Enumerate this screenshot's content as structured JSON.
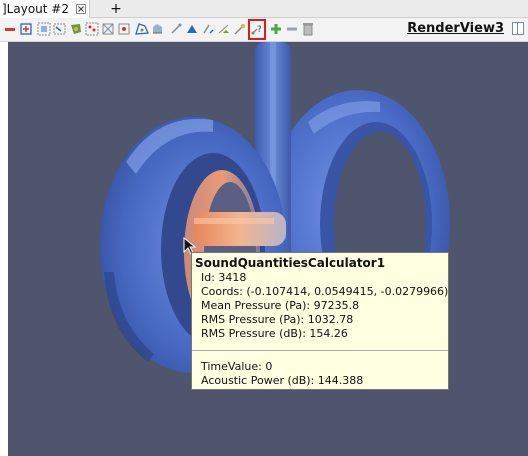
{
  "tabbar": {
    "tab_label": "]Layout #2",
    "add_label": "+"
  },
  "toolbar": {
    "view_name": "RenderView3"
  },
  "tooltip": {
    "title": "SoundQuantitiesCalculator1",
    "id": "Id: 3418",
    "coords": "Coords: (-0.107414, 0.0549415, -0.0279966)",
    "mean_pressure": "Mean Pressure (Pa): 97235.8",
    "rms_pressure_pa": "RMS Pressure (Pa): 1032.78",
    "rms_pressure_db": "RMS Pressure (dB): 154.26",
    "time_value": "TimeValue: 0",
    "acoustic_power": "Acoustic Power (dB): 144.388"
  },
  "colors": {
    "background": "#50556e",
    "surface": "#4a6ac0",
    "highlight_border": "#e01b1b",
    "tooltip_bg": "#ffffe1"
  }
}
